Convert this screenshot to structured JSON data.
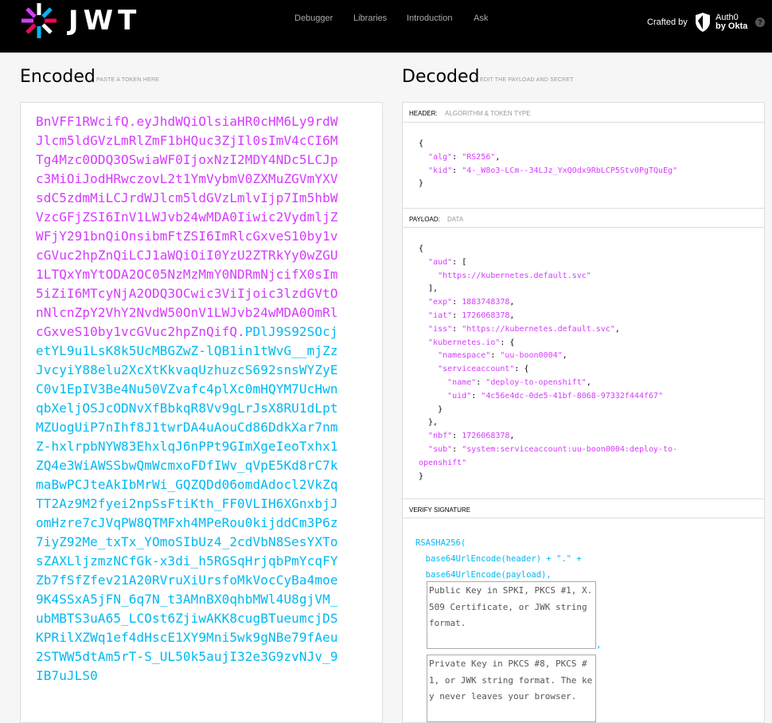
{
  "header": {
    "logo_text": "JWT",
    "nav": [
      "Debugger",
      "Libraries",
      "Introduction",
      "Ask"
    ],
    "crafted_by": "Crafted by",
    "brand_line1": "Auth0",
    "brand_line2": "by Okta",
    "help": "?"
  },
  "encoded": {
    "title": "Encoded",
    "subtitle": "PASTE A TOKEN HERE",
    "token_text": "BnVFF1RWcifQ.eyJhdWQiOlsiaHR0cHM6Ly9rdWJlcm5ldGVzLmRlZmF1bHQuc3ZjIl0sImV4cCI6MTg4Mzc0ODQ3OSwiaWF0IjoxNzI2MDY4NDc5LCJpc3MiOiJodHRwczovL2t1YmVybmV0ZXMuZGVmYXVsdC5zdmMiLCJrdWJlcm5ldGVzLmlvIjp7Im5hbWVzcGFjZSI6InV1LWJvb24wMDA0Iiwic2VydmljZWFjY291bnQiOnsibmFtZSI6ImRlcGxveS10by1vcGVuc2hpZnQiLCJ1aWQiOiI0YzU2ZTRkYy0wZGU1LTQxYmYtODA2OC05NzMzMmY0NDRmNjcifX0sIm5iZiI6MTcyNjA2ODQ3OCwic3ViIjoic3lzdGVtOnNlcnZpY2VhY2NvdW50OnV1LWJvb24wMDA0OmRlcGxveS10by1vcGVuc2hpZnQifQ.",
    "signature_text": "PDlJ9S92SOcjetYL9u1LsK8k5UcMBGZwZ-lQB1in1tWvG__mjZzJvcyiY88elu2XcXtKkvaqUzhuzcS692snsWYZyEC0v1EpIV3Be4Nu50VZvafc4plXc0mHQYM7UcHwnqbXeljOSJcODNvXfBbkqR8Vv9gLrJsX8RU1dLptMZUogUiP7nIhf8J1twrDA4uAouCd86DdkXar7nmZ-hxlrpbNYW83EhxlqJ6nPPt9GImXgeIeoTxhx1ZQ4e3WiAWSSbwQmWcmxoFDfIWv_qVpE5Kd8rC7kmaBwPCJteAkIbMrWi_GQZQDd06omdAdocl2VkZqTT2Az9M2fyei2npSsFtiKth_FF0VLIH6XGnxbjJomHzre7cJVqPW8QTMFxh4MPeRou0kijddCm3P6z7iyZ92Me_txTx_YOmoSIbUz4_2cdVbN8SesYXTosZAXLljzmzNCfGk-x3di_h5RGSqHrjqbPmYcqFYZb7fSfZfev21A20RVruXiUrsfoMkVocCyBa4moe9K4SSxA5jFN_6q7N_t3AMnBX0qhbMWl4U8gjVM_ubMBTS3uA65_LCOst6ZjiwAKK8cugBTueumcjDSKPRilXZWq1ef4dHscE1XY9Mni5wk9gNBe79fAeu2STWW5dtAm5rT-S_UL50k5aujI32e3G9zvNJv_9IB7uJLS0"
  },
  "decoded": {
    "title": "Decoded",
    "subtitle": "EDIT THE PAYLOAD AND SECRET",
    "header_label": "HEADER:",
    "header_sub": "ALGORITHM & TOKEN TYPE",
    "payload_label": "PAYLOAD:",
    "payload_sub": "DATA",
    "verify_label": "VERIFY SIGNATURE",
    "header_json": {
      "alg": "RS256",
      "kid": "4-_W8o3-LCm--34LJz_YxQOdx9RbLCP5Stv0PgTQuEg"
    },
    "payload_json": {
      "aud": [
        "https://kubernetes.default.svc"
      ],
      "exp": 1883748378,
      "iat": 1726068378,
      "iss": "https://kubernetes.default.svc",
      "namespace": "uu-boon0004",
      "sa_name": "deploy-to-openshift",
      "sa_uid": "4c56e4dc-0de5-41bf-8068-97332f444f67",
      "nbf": 1726068378,
      "sub_line1": "system:serviceaccount:uu-boon0004:deploy-to-",
      "sub_line2": "openshift"
    },
    "verify_lines": [
      "RSASHA256(",
      "  base64UrlEncode(header) + \".\" +",
      "  base64UrlEncode(payload),"
    ],
    "public_key_placeholder": "Public Key in SPKI, PKCS #1, X.509 Certificate, or JWK string format.",
    "private_key_placeholder": "Private Key in PKCS #8, PKCS #1, or JWK string format. The key never leaves your browser."
  }
}
